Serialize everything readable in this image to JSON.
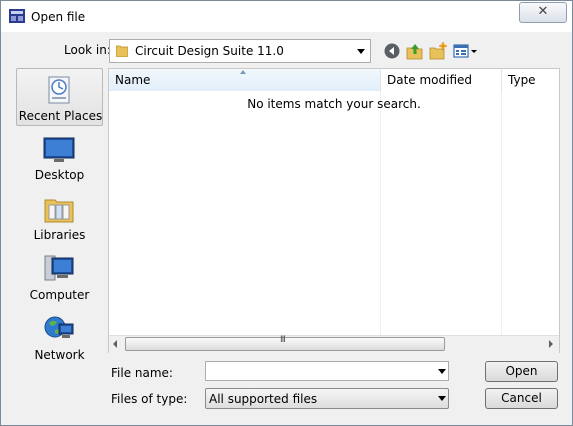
{
  "window": {
    "title": "Open file",
    "close_symbol": "✕"
  },
  "lookin": {
    "label": "Look in:",
    "value": "Circuit Design Suite 11.0"
  },
  "toolbar": {
    "icons": [
      "back-icon",
      "up-folder-icon",
      "new-folder-icon",
      "view-menu-icon"
    ]
  },
  "places": [
    {
      "label": "Recent Places",
      "icon": "recent-places-icon",
      "selected": true
    },
    {
      "label": "Desktop",
      "icon": "desktop-icon"
    },
    {
      "label": "Libraries",
      "icon": "libraries-icon"
    },
    {
      "label": "Computer",
      "icon": "computer-icon"
    },
    {
      "label": "Network",
      "icon": "network-icon"
    }
  ],
  "file_list": {
    "columns": [
      "Name",
      "Date modified",
      "Type"
    ],
    "sorted_column": "Name",
    "empty_message": "No items match your search.",
    "scroll_grip": "III"
  },
  "filename": {
    "label": "File name:",
    "value": ""
  },
  "filetype": {
    "label": "Files of type:",
    "value": "All supported files"
  },
  "buttons": {
    "open": "Open",
    "cancel": "Cancel"
  },
  "colors": {
    "selected_header": "#e1eefa",
    "border": "#abadb3"
  }
}
